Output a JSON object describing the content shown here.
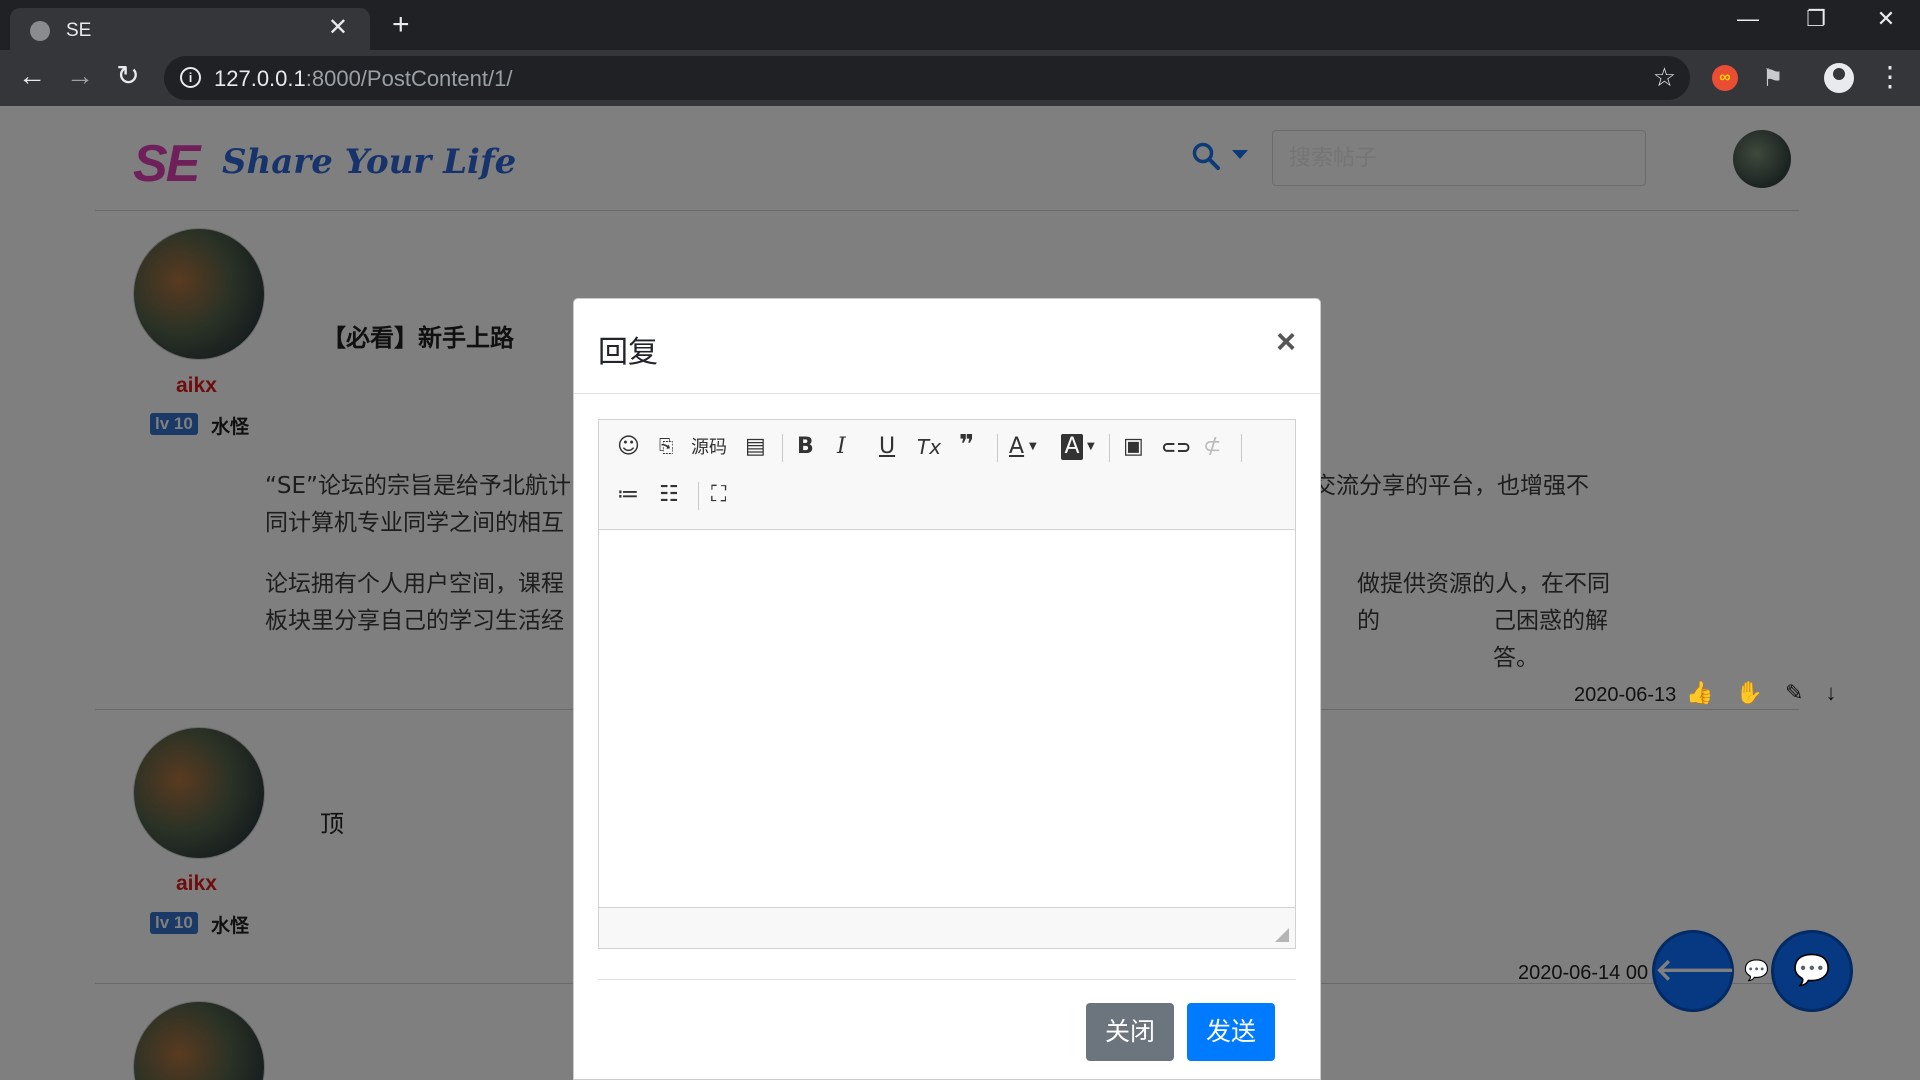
{
  "browser": {
    "tab_title": "SE",
    "tab_close": "✕",
    "new_tab": "+",
    "url_host": "127.0.0.1",
    "url_rest": ":8000/PostContent/1/",
    "controls": {
      "minimize": "—",
      "restore": "❐",
      "close": "✕"
    },
    "nav": {
      "back": "←",
      "forward": "→",
      "reload": "↻"
    },
    "bookmark_star": "☆",
    "menu": "⋮"
  },
  "site": {
    "logo_mark_1": "S",
    "logo_mark_2": "E",
    "logo_text": "Share Your Life",
    "search_placeholder": "搜索帖子"
  },
  "posts": [
    {
      "author": "aikx",
      "level": "lv 10",
      "rank": "水怪",
      "title": "【必看】新手上路",
      "para1_line1": "“SE”论坛的宗旨是给予北航计",
      "para1_line1_tail": "交流分享的平台，也增强不",
      "para1_line2": "同计算机专业同学之间的相互",
      "para2_line1": "论坛拥有个人用户空间，课程",
      "para2_line1_tail": "做提供资源的人，在不同的",
      "para2_line2": "板块里分享自己的学习生活经",
      "para2_line2_tail": "己困惑的解答。",
      "date": "2020-06-13",
      "icons": "👍 ✋ ✎ ↓"
    },
    {
      "author": "aikx",
      "level": "lv 10",
      "rank": "水怪",
      "content": "顶",
      "date": "2020-06-14 00"
    }
  ],
  "modal": {
    "title": "回复",
    "close_x": "×",
    "toolbar": {
      "emoji": "☺",
      "source_icon": "⎘",
      "source_label": "源码",
      "template": "▤",
      "bold": "B",
      "italic": "I",
      "underline": "U",
      "clear_format": "Tx",
      "quote": "❞",
      "text_color": "A",
      "bg_color": "A",
      "image": "▣",
      "link": "⊂⊃",
      "unlink": "⊄",
      "ordered_list": "≔",
      "bullet_list": "☷",
      "fullscreen": "⛶"
    },
    "btn_close": "关闭",
    "btn_send": "发送"
  },
  "fab": {
    "back": "🡐",
    "chat": "💬",
    "chat_small": "💬"
  }
}
